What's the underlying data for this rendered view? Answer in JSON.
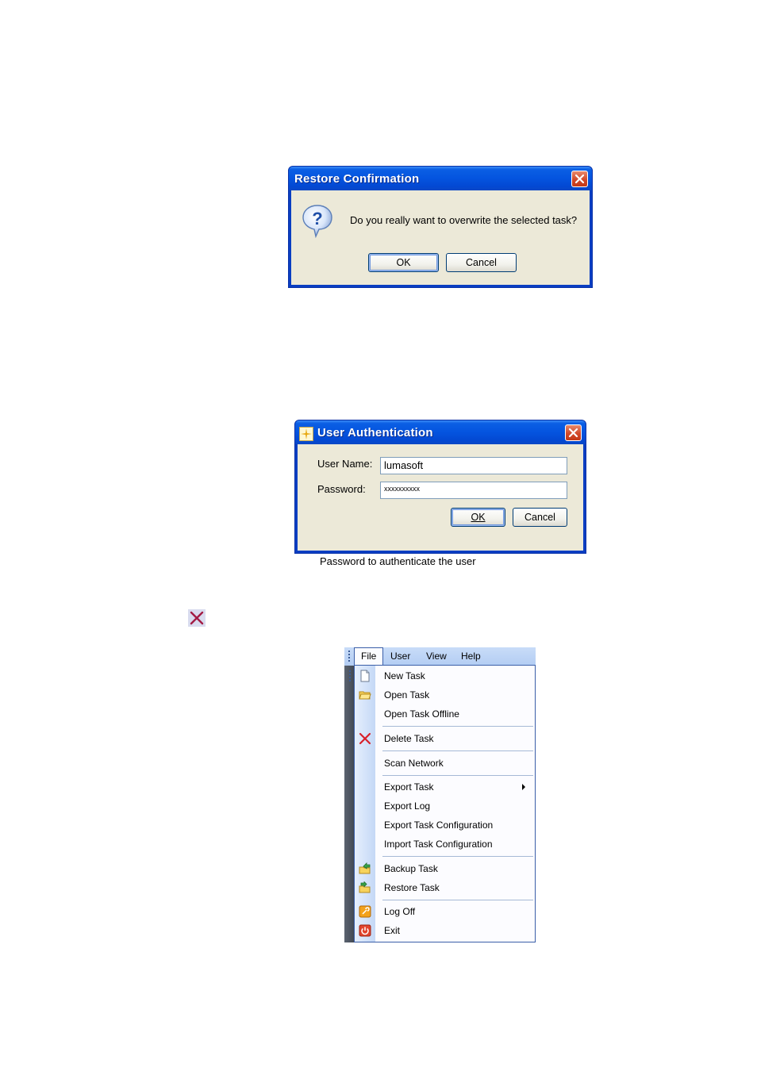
{
  "restore_dialog": {
    "title": "Restore Confirmation",
    "message": "Do you really want to overwrite the selected task?",
    "ok_label": "OK",
    "cancel_label": "Cancel"
  },
  "auth_dialog": {
    "title": "User Authentication",
    "username_label": "User Name:",
    "username_value": "lumasoft",
    "password_label": "Password:",
    "password_value": "xxxxxxxxxx",
    "ok_label": "OK",
    "cancel_label": "Cancel",
    "status_text": "Password to authenticate the user"
  },
  "menubar": {
    "items": [
      "File",
      "User",
      "View",
      "Help"
    ],
    "open_menu": "File"
  },
  "file_menu": {
    "items": [
      {
        "label": "New Task",
        "icon": "new-task-icon"
      },
      {
        "label": "Open Task",
        "icon": "open-folder-icon"
      },
      {
        "label": "Open Task Offline",
        "icon": ""
      },
      {
        "label": "Delete Task",
        "icon": "delete-x-icon"
      },
      {
        "label": "Scan Network",
        "icon": ""
      },
      {
        "label": "Export Task",
        "icon": "",
        "submenu": true
      },
      {
        "label": "Export Log",
        "icon": ""
      },
      {
        "label": "Export Task Configuration",
        "icon": ""
      },
      {
        "label": "Import Task Configuration",
        "icon": ""
      },
      {
        "label": "Backup Task",
        "icon": "backup-folder-icon"
      },
      {
        "label": "Restore Task",
        "icon": "restore-folder-icon"
      },
      {
        "label": "Log Off",
        "icon": "log-off-icon"
      },
      {
        "label": "Exit",
        "icon": "exit-power-icon"
      }
    ]
  },
  "colors": {
    "xp_title": "#0454df",
    "dialog_face": "#ece9d8",
    "close_button": "#d2492a",
    "menubar": "#c1d6f6",
    "menu_border": "#3a5ea8"
  }
}
